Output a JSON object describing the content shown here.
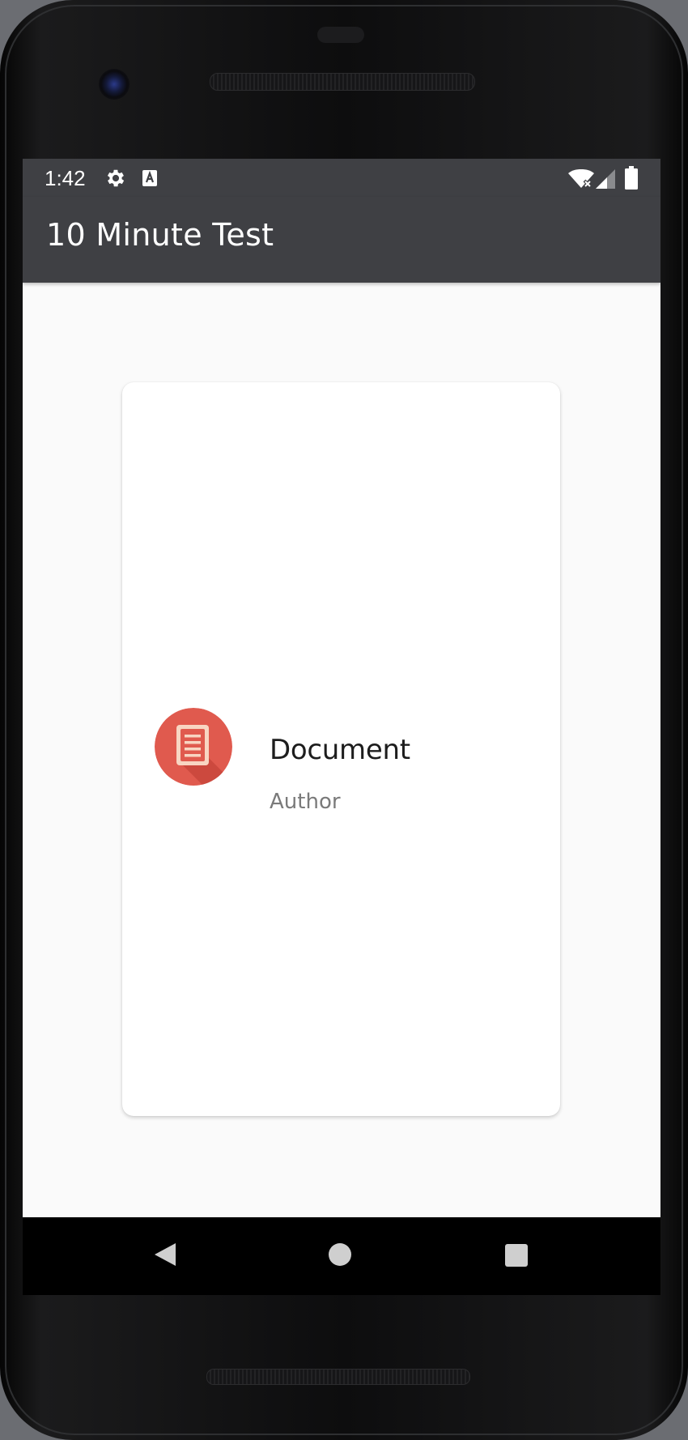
{
  "status_bar": {
    "time": "1:42",
    "icons": [
      "settings-gear-icon",
      "accessibility-a-icon",
      "wifi-off-icon",
      "cell-signal-icon",
      "battery-icon"
    ]
  },
  "app_bar": {
    "title": "10 Minute Test"
  },
  "card": {
    "title": "Document",
    "author": "Author",
    "icon": "document-icon",
    "icon_color": "#e05a4e"
  },
  "nav_bar": {
    "buttons": [
      "back",
      "home",
      "recents"
    ]
  },
  "colors": {
    "app_bar": "#3f4044",
    "background": "#fafafa",
    "card": "#ffffff"
  }
}
